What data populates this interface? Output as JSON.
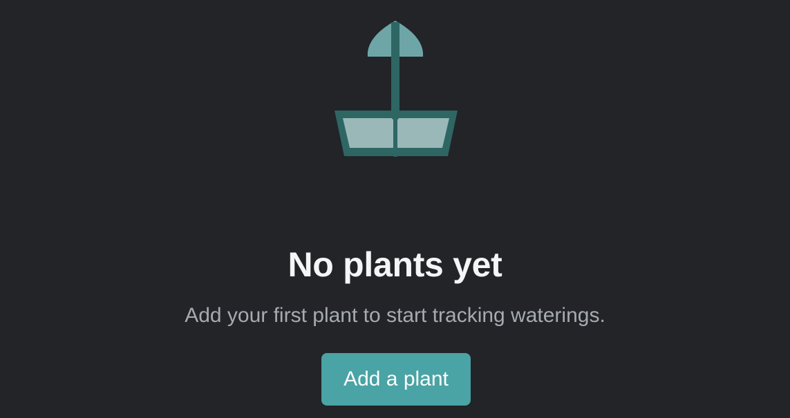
{
  "empty_state": {
    "illustration_icon": "potted-plant-icon",
    "title": "No plants yet",
    "message": "Add your first plant to start tracking waterings.",
    "cta_label": "Add a plant"
  },
  "colors": {
    "background": "#222428",
    "accent": "#4aa3a5",
    "plant_dark": "#2e6664",
    "plant_leaf": "#6ea6a8",
    "pot_fill": "#9bb8b8",
    "title": "#f4f5f6",
    "message": "#a6abb0"
  }
}
